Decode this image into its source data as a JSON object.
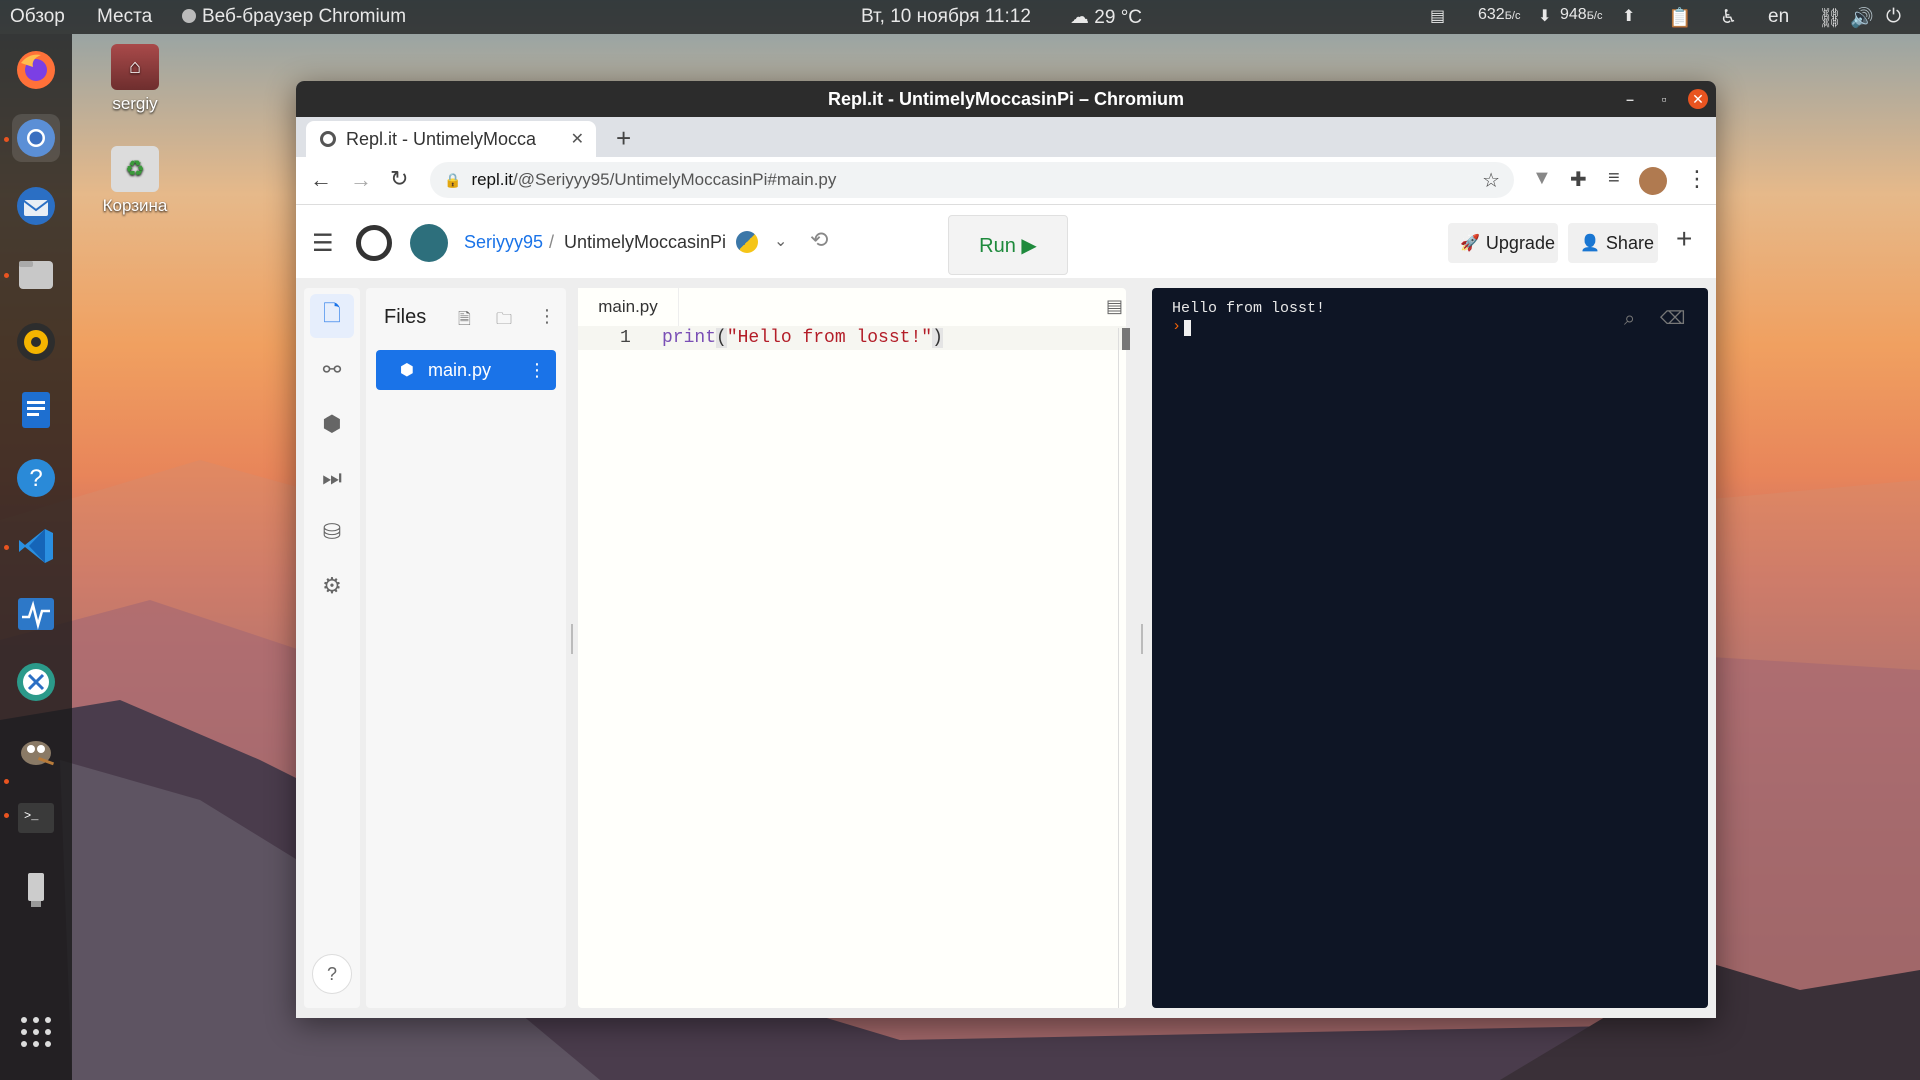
{
  "topbar": {
    "overview": "Обзор",
    "places": "Места",
    "app_name": "Веб-браузер Chromium",
    "datetime": "Вт, 10 ноября  11:12",
    "weather": "29 °C",
    "net_down": "632",
    "net_down_unit": "Б/с",
    "net_up": "948",
    "net_up_unit": "Б/с",
    "lang": "en"
  },
  "desktop": {
    "home_label": "sergiy",
    "trash_label": "Корзина"
  },
  "window": {
    "title": "Repl.it - UntimelyMoccasinPi – Chromium"
  },
  "browser": {
    "tab_title": "Repl.it - UntimelyMocca",
    "url_host": "repl.it",
    "url_path": "/@Seriyyy95/UntimelyMoccasinPi#main.py"
  },
  "replit": {
    "user": "Seriyyy95",
    "separator": "/",
    "repl_name": "UntimelyMoccasinPi",
    "run_label": "Run ▶",
    "upgrade_label": "Upgrade",
    "share_label": "Share",
    "files_title": "Files",
    "file_name": "main.py",
    "editor_tab": "main.py",
    "line_number": "1",
    "code_func": "print",
    "code_open": "(",
    "code_string": "\"Hello from losst!\"",
    "code_close": ")",
    "console_output": "Hello from losst!",
    "prompt": "›",
    "help_label": "?"
  },
  "colors": {
    "replit_blue": "#1a73e8",
    "run_green": "#1e8a3c",
    "console_bg": "#0e1525",
    "prompt_orange": "#f26207"
  }
}
